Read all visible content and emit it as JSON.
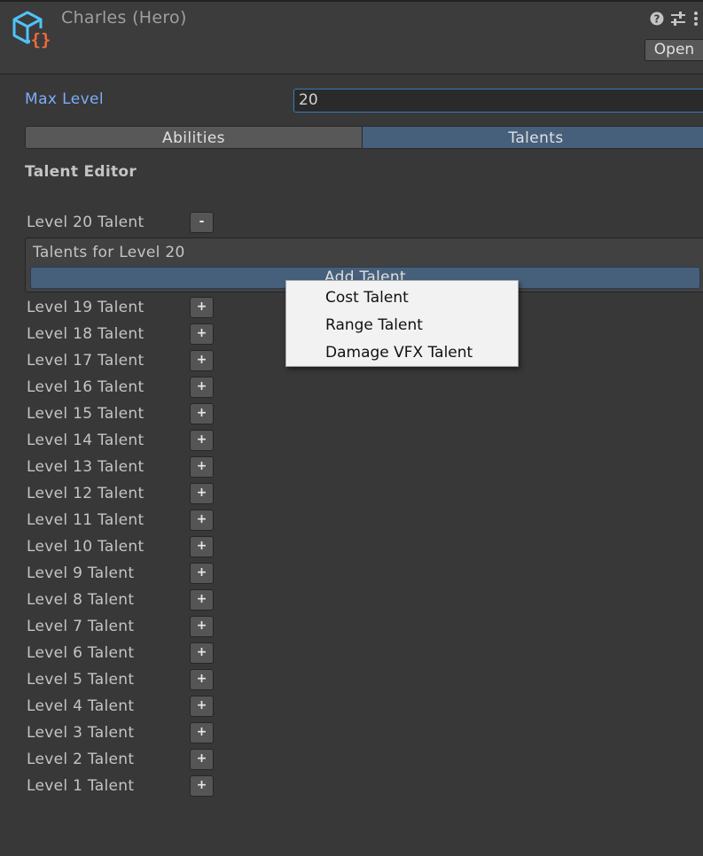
{
  "header": {
    "title": "Charles (Hero)",
    "open_label": "Open",
    "icons": [
      "cube-script-icon",
      "help-icon",
      "presets-icon",
      "more-menu-icon"
    ],
    "accent_colors": {
      "cube": "#4fc3f7",
      "braces": "#f26b3a"
    }
  },
  "max_level": {
    "label": "Max Level",
    "value": "20"
  },
  "tabs": [
    {
      "label": "Abilities",
      "selected": false
    },
    {
      "label": "Talents",
      "selected": true
    }
  ],
  "talent_editor": {
    "title": "Talent Editor",
    "expanded": {
      "label": "Level 20 Talent",
      "button": "-",
      "box_title": "Talents for Level 20",
      "add_button": "Add Talent"
    },
    "levels": [
      {
        "label": "Level 19 Talent",
        "button": "+"
      },
      {
        "label": "Level 18 Talent",
        "button": "+"
      },
      {
        "label": "Level 17 Talent",
        "button": "+"
      },
      {
        "label": "Level 16 Talent",
        "button": "+"
      },
      {
        "label": "Level 15 Talent",
        "button": "+"
      },
      {
        "label": "Level 14 Talent",
        "button": "+"
      },
      {
        "label": "Level 13 Talent",
        "button": "+"
      },
      {
        "label": "Level 12 Talent",
        "button": "+"
      },
      {
        "label": "Level 11 Talent",
        "button": "+"
      },
      {
        "label": "Level 10 Talent",
        "button": "+"
      },
      {
        "label": "Level 9 Talent",
        "button": "+"
      },
      {
        "label": "Level 8 Talent",
        "button": "+"
      },
      {
        "label": "Level 7 Talent",
        "button": "+"
      },
      {
        "label": "Level 6 Talent",
        "button": "+"
      },
      {
        "label": "Level 5 Talent",
        "button": "+"
      },
      {
        "label": "Level 4 Talent",
        "button": "+"
      },
      {
        "label": "Level 3 Talent",
        "button": "+"
      },
      {
        "label": "Level 2 Talent",
        "button": "+"
      },
      {
        "label": "Level 1 Talent",
        "button": "+"
      }
    ]
  },
  "context_menu": {
    "items": [
      "Cost Talent",
      "Range Talent",
      "Damage VFX Talent"
    ]
  }
}
